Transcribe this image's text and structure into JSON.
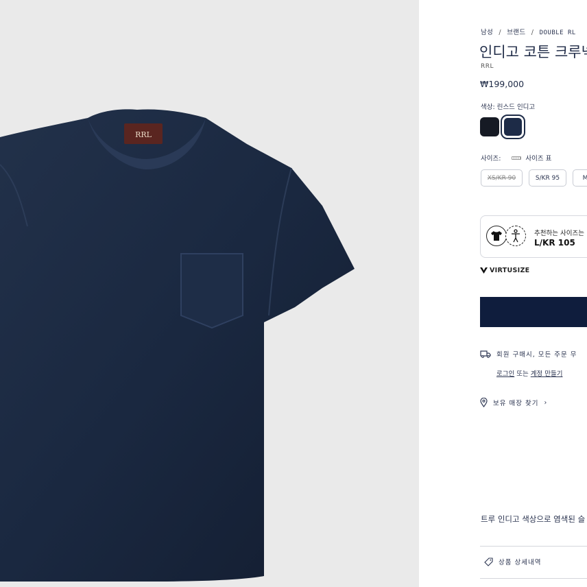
{
  "breadcrumb": {
    "items": [
      "남성",
      "브랜드",
      "DOUBLE RL"
    ],
    "separator": "/"
  },
  "product": {
    "title": "인디고 코튼 크루넥",
    "brand": "RRL",
    "price": "₩199,000",
    "image_alt": "indigo cotton crewneck pocket t-shirt",
    "tag_text": "RRL"
  },
  "color": {
    "label": "색상: 린스드 인디고",
    "swatches": [
      "#161a24",
      "#1d2b47"
    ],
    "selected_index": 1
  },
  "size": {
    "label": "사이즈:",
    "chart_label": "사이즈 표",
    "options": [
      {
        "label": "XS/KR 90",
        "available": false
      },
      {
        "label": "S/KR 95",
        "available": true
      },
      {
        "label": "M/",
        "available": true
      }
    ]
  },
  "virtusize": {
    "recommend_label": "추천하는 사이즈는",
    "recommended_size": "L/KR 105",
    "logo_text": "VIRTUSIZE"
  },
  "shipping": {
    "text": "회원 구매시, 모든 주문 무",
    "login": "로그인",
    "or": "또는",
    "signup": "계정 만들기"
  },
  "store": {
    "text": "보유 매장 찾기"
  },
  "description": {
    "text": "트루 인디고 색상으로 염색된 슬"
  },
  "details": {
    "label": "상품 상세내역"
  },
  "colors": {
    "primary": "#0f1d3d",
    "shirt": "#1b2940",
    "background": "#eaeaea"
  }
}
